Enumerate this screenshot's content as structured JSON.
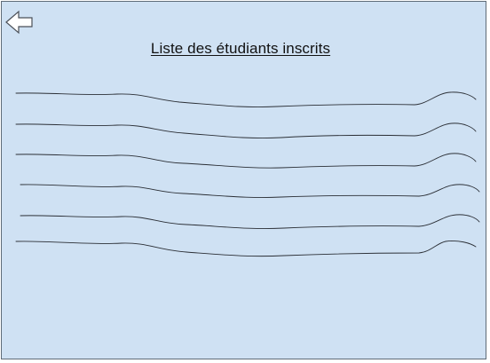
{
  "header": {
    "title": "Liste des étudiants inscrits",
    "back_icon": "arrow-left-icon"
  },
  "student_list": {
    "item_count": 6,
    "items": [
      "",
      "",
      "",
      "",
      "",
      ""
    ]
  },
  "colors": {
    "background": "#cfe1f3",
    "border": "#5f6b77",
    "line": "#2b2f36"
  }
}
